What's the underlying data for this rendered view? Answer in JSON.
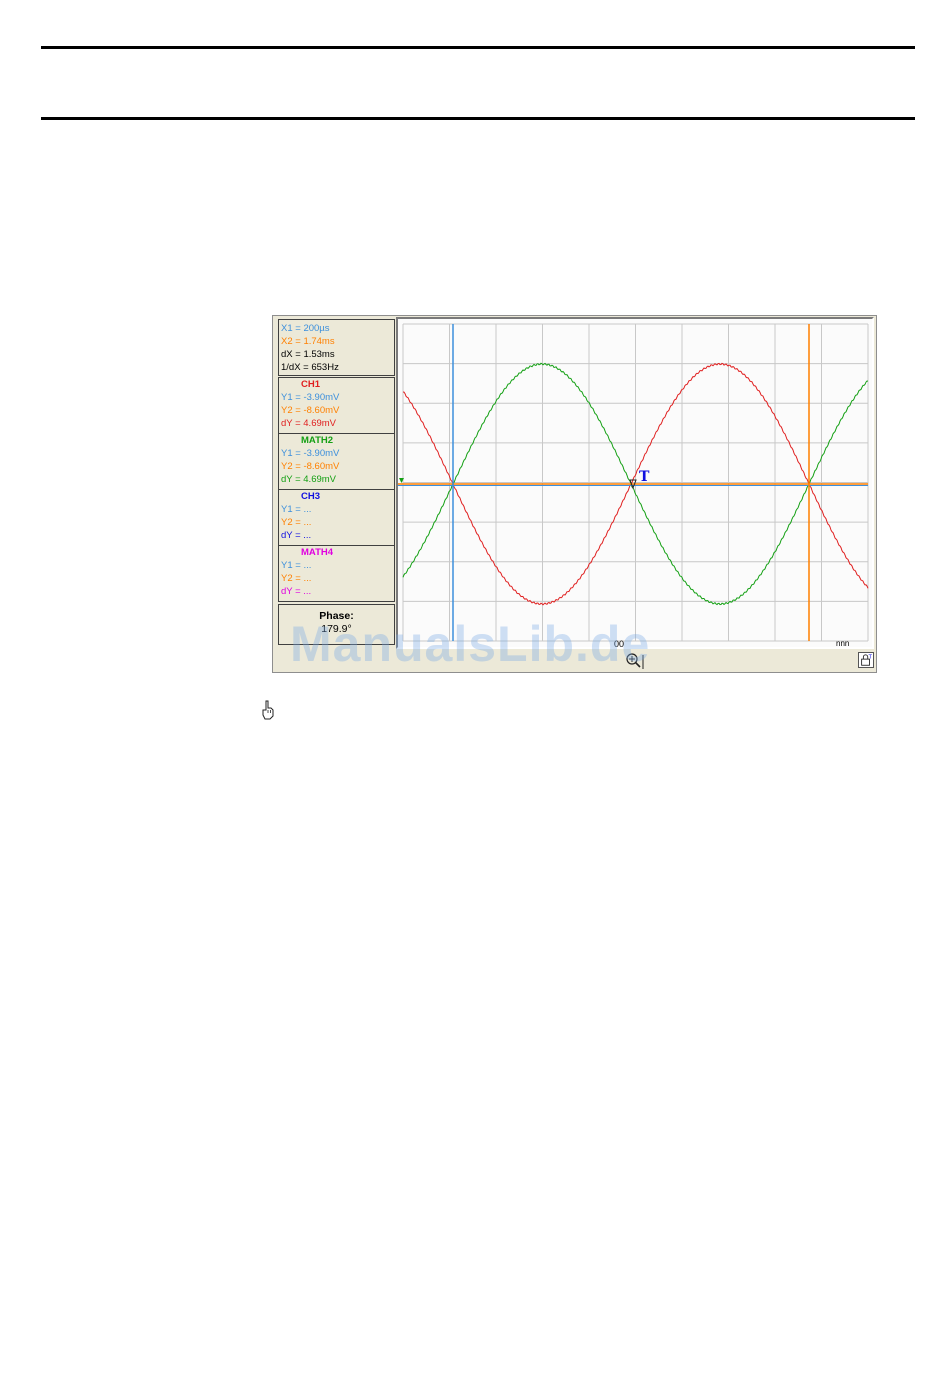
{
  "colors": {
    "cursor1": "#3c8fdc",
    "cursor2": "#ff8000",
    "ch1": "#e02020",
    "math2": "#14a014",
    "ch3": "#1010e0",
    "math4": "#e000e0",
    "grid": "#c8c8c8",
    "watermark": "#78aae6"
  },
  "cursors": {
    "x1": "X1 = 200µs",
    "x2": "X2 = 1.74ms",
    "dx": "dX = 1.53ms",
    "inv_dx": "1/dX = 653Hz"
  },
  "ch1": {
    "title": "CH1",
    "y1": "Y1 = -3.90mV",
    "y2": "Y2 = -8.60mV",
    "dy": "dY = 4.69mV"
  },
  "math2": {
    "title": "MATH2",
    "y1": "Y1 = -3.90mV",
    "y2": "Y2 = -8.60mV",
    "dy": "dY = 4.69mV"
  },
  "ch3": {
    "title": "CH3",
    "y1": "Y1 = ...",
    "y2": "Y2 = ...",
    "dy": "dY = ..."
  },
  "math4": {
    "title": "MATH4",
    "y1": "Y1 = ...",
    "y2": "Y2 = ...",
    "dy": "dY = ..."
  },
  "phase": {
    "label": "Phase:",
    "value": "179.9°"
  },
  "trigger_marker": "T",
  "status": {
    "left": "00",
    "right": "nnn"
  },
  "watermark": "ManualsLib.de",
  "icons": {
    "lock": "lock-icon",
    "zoom": "zoom-icon",
    "hand": "pointing-hand-icon"
  },
  "chart_data": {
    "type": "line",
    "series": [
      {
        "name": "CH1",
        "waveform": "sine",
        "phase_deg": 180,
        "cycles_visible": 1.3
      },
      {
        "name": "MATH2",
        "waveform": "sine",
        "phase_deg": 0,
        "cycles_visible": 1.3
      }
    ],
    "grid": true
  }
}
